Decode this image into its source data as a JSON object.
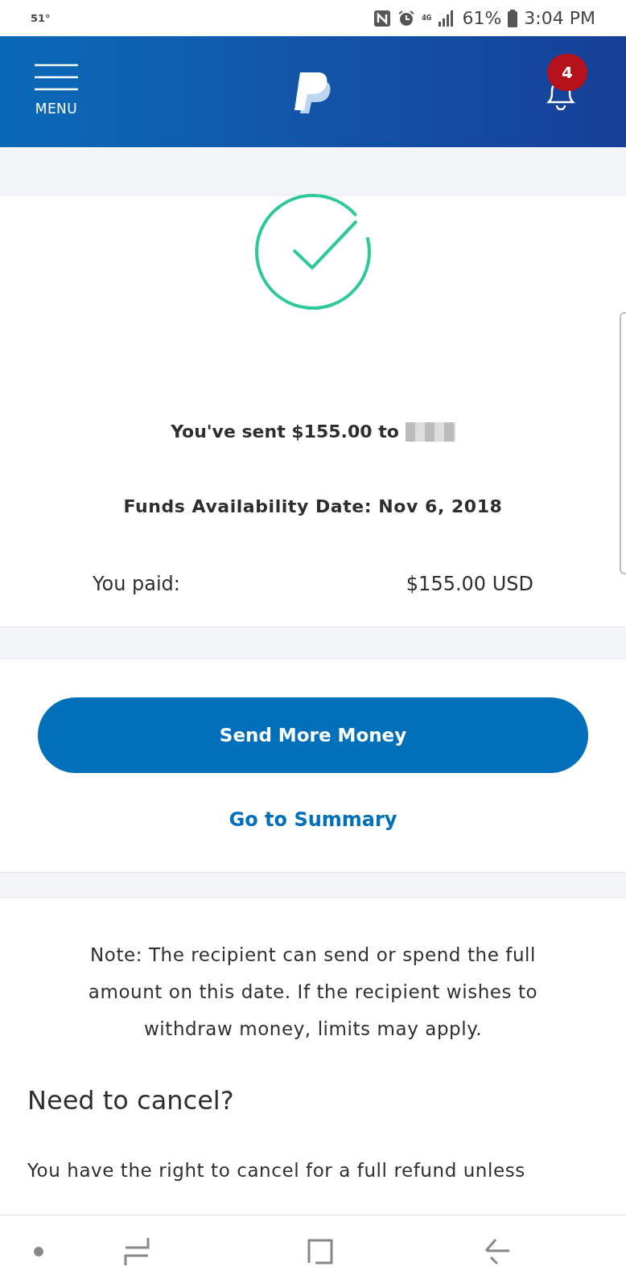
{
  "status_bar": {
    "temperature": "51°",
    "network": "4G",
    "battery": "61%",
    "time": "3:04 PM"
  },
  "header": {
    "menu_label": "MENU",
    "notification_count": "4"
  },
  "confirmation": {
    "sent_text": "You've sent $155.00 to",
    "recipient_redacted": true,
    "availability": "Funds Availability Date: Nov 6, 2018",
    "paid_label": "You paid:",
    "paid_amount": "$155.00 USD"
  },
  "actions": {
    "primary_button": "Send More Money",
    "link": "Go to Summary"
  },
  "note": {
    "text": "Note: The recipient can send or spend the full amount on this date. If the recipient wishes to withdraw money, limits may apply.",
    "heading": "Need to cancel?",
    "body": "You have the right to cancel for a full refund unless"
  }
}
